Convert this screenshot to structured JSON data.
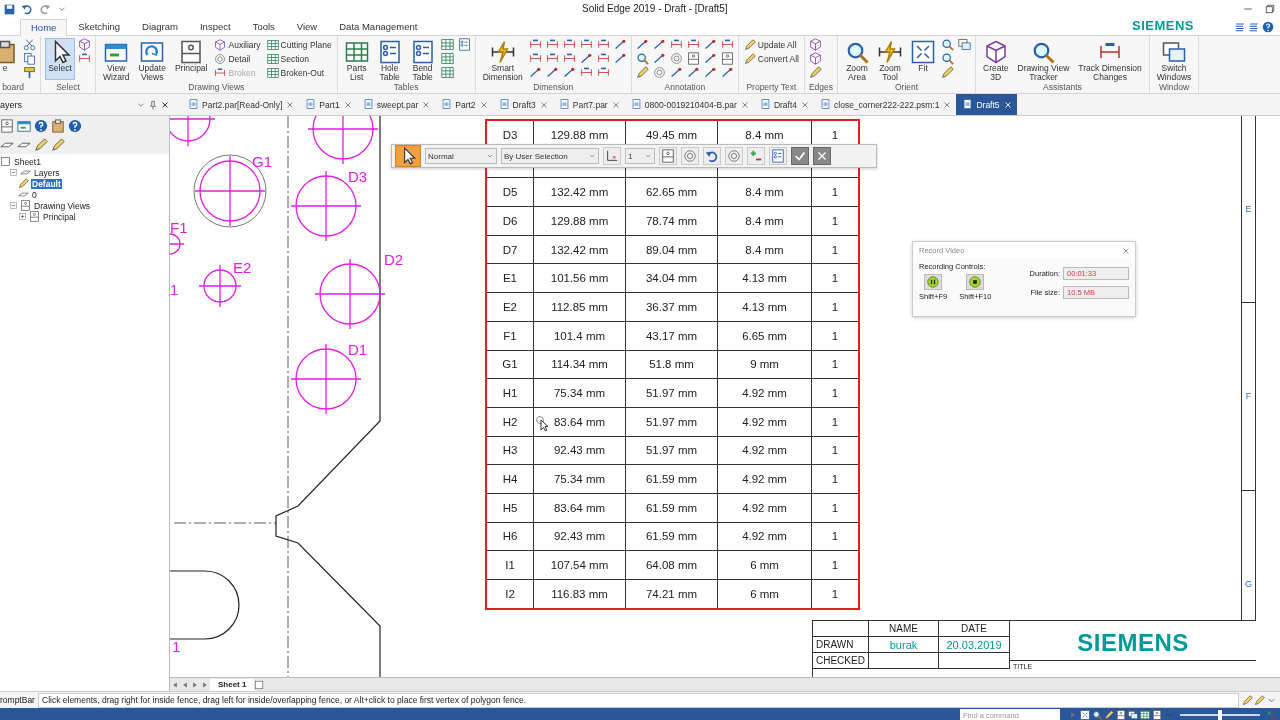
{
  "title_bar": {
    "title": "Solid Edge 2019 - Draft - [Draft5]"
  },
  "ribbon": {
    "tabs": [
      {
        "label": "Home",
        "selected": true
      },
      {
        "label": "Sketching",
        "selected": false
      },
      {
        "label": "Diagram",
        "selected": false
      },
      {
        "label": "Inspect",
        "selected": false
      },
      {
        "label": "Tools",
        "selected": false
      },
      {
        "label": "View",
        "selected": false
      },
      {
        "label": "Data Management",
        "selected": false
      }
    ],
    "logo": "SIEMENS",
    "groups": [
      {
        "label": "board",
        "buttons": [
          {
            "kind": "large",
            "label": "e",
            "active": false
          }
        ]
      },
      {
        "label": "Select",
        "buttons": [
          {
            "kind": "large",
            "label": "Select",
            "active": true
          }
        ]
      },
      {
        "label": "Drawing Views",
        "buttons": [
          {
            "kind": "large",
            "label": "View\nWizard",
            "active": false
          },
          {
            "kind": "large",
            "label": "Update\nViews",
            "active": false
          },
          {
            "kind": "large",
            "label": "Principal",
            "active": false
          },
          {
            "kind": "small",
            "label": "Auxiliary",
            "disabled": false
          },
          {
            "kind": "small",
            "label": "Detail",
            "disabled": false
          },
          {
            "kind": "small",
            "label": "Broken",
            "disabled": true
          },
          {
            "kind": "small",
            "label": "Cutting Plane",
            "disabled": false
          },
          {
            "kind": "small",
            "label": "Section",
            "disabled": false
          },
          {
            "kind": "small",
            "label": "Broken-Out",
            "disabled": false
          }
        ]
      },
      {
        "label": "Tables",
        "buttons": [
          {
            "kind": "large",
            "label": "Parts\nList",
            "active": false
          },
          {
            "kind": "large",
            "label": "Hole\nTable",
            "active": false
          },
          {
            "kind": "large",
            "label": "Bend\nTable",
            "active": false
          }
        ]
      },
      {
        "label": "Dimension",
        "buttons": [
          {
            "kind": "large",
            "label": "Smart\nDimension",
            "active": false
          }
        ]
      },
      {
        "label": "Annotation"
      },
      {
        "label": "Property Text",
        "buttons": [
          {
            "kind": "small",
            "label": "Update All",
            "disabled": false
          },
          {
            "kind": "small",
            "label": "Convert All",
            "disabled": false
          }
        ]
      },
      {
        "label": "Edges"
      },
      {
        "label": "Orient",
        "buttons": [
          {
            "kind": "large",
            "label": "Zoom\nArea",
            "active": false
          },
          {
            "kind": "large",
            "label": "Zoom\nTool",
            "active": false
          },
          {
            "kind": "large",
            "label": "Fit",
            "active": false
          }
        ]
      },
      {
        "label": "Assistants",
        "buttons": [
          {
            "kind": "large",
            "label": "Create\n3D",
            "active": false
          },
          {
            "kind": "large",
            "label": "Drawing View\nTracker",
            "active": false
          },
          {
            "kind": "large",
            "label": "Track Dimension\nChanges",
            "active": false
          }
        ]
      },
      {
        "label": "Window",
        "buttons": [
          {
            "kind": "large",
            "label": "Switch\nWindows",
            "active": false
          }
        ]
      }
    ]
  },
  "panel": {
    "title": "ayers"
  },
  "document_tabs": [
    {
      "label": "Part2.par[Read-Only]",
      "selected": false
    },
    {
      "label": "Part1",
      "selected": false
    },
    {
      "label": "sweept.par",
      "selected": false
    },
    {
      "label": "Part2",
      "selected": false
    },
    {
      "label": "Draft3",
      "selected": false
    },
    {
      "label": "Part7.par",
      "selected": false
    },
    {
      "label": "0800-0019210404-B.par",
      "selected": false
    },
    {
      "label": "Draft4",
      "selected": false
    },
    {
      "label": "close_corner222-222.psm:1",
      "selected": false
    },
    {
      "label": "Draft5",
      "selected": true
    }
  ],
  "tree": [
    {
      "label": "Sheet1",
      "selected": false,
      "children": [
        {
          "label": "Layers",
          "selected": false,
          "expanded": true,
          "children": [
            {
              "label": "Default",
              "selected": true
            },
            {
              "label": "0",
              "selected": false
            }
          ]
        },
        {
          "label": "Drawing Views",
          "selected": false,
          "expanded": true,
          "children": [
            {
              "label": "Principal",
              "selected": false,
              "expanded": false
            }
          ]
        }
      ]
    }
  ],
  "drawing": {
    "hole_labels": [
      "G1",
      "D3",
      "F1",
      "E2",
      "D2",
      "1",
      "D1",
      "1"
    ]
  },
  "hole_table": {
    "rows": [
      {
        "cells": [
          "D3",
          "129.88 mm",
          "49.45 mm",
          "8.4 mm",
          "1"
        ]
      },
      {
        "covered": true
      },
      {
        "cells": [
          "D5",
          "132.42 mm",
          "62.65 mm",
          "8.4 mm",
          "1"
        ]
      },
      {
        "cells": [
          "D6",
          "129.88 mm",
          "78.74 mm",
          "8.4 mm",
          "1"
        ]
      },
      {
        "cells": [
          "D7",
          "132.42 mm",
          "89.04 mm",
          "8.4 mm",
          "1"
        ]
      },
      {
        "cells": [
          "E1",
          "101.56 mm",
          "34.04 mm",
          "4.13 mm",
          "1"
        ]
      },
      {
        "cells": [
          "E2",
          "112.85 mm",
          "36.37 mm",
          "4.13 mm",
          "1"
        ]
      },
      {
        "cells": [
          "F1",
          "101.4 mm",
          "43.17 mm",
          "6.65 mm",
          "1"
        ]
      },
      {
        "cells": [
          "G1",
          "114.34 mm",
          "51.8 mm",
          "9 mm",
          "1"
        ]
      },
      {
        "cells": [
          "H1",
          "75.34 mm",
          "51.97 mm",
          "4.92 mm",
          "1"
        ]
      },
      {
        "cells": [
          "H2",
          "83.64 mm",
          "51.97 mm",
          "4.92 mm",
          "1"
        ]
      },
      {
        "cells": [
          "H3",
          "92.43 mm",
          "51.97 mm",
          "4.92 mm",
          "1"
        ]
      },
      {
        "cells": [
          "H4",
          "75.34 mm",
          "61.59 mm",
          "4.92 mm",
          "1"
        ]
      },
      {
        "cells": [
          "H5",
          "83.64 mm",
          "61.59 mm",
          "4.92 mm",
          "1"
        ]
      },
      {
        "cells": [
          "H6",
          "92.43 mm",
          "61.59 mm",
          "4.92 mm",
          "1"
        ]
      },
      {
        "cells": [
          "I1",
          "107.54 mm",
          "64.08 mm",
          "6 mm",
          "1"
        ]
      },
      {
        "cells": [
          "I2",
          "116.83 mm",
          "74.21 mm",
          "6 mm",
          "1"
        ]
      }
    ]
  },
  "selection_toolbar": {
    "select_active": true,
    "mode": "Normal",
    "selection": "By User Selection",
    "count": "1"
  },
  "record_video": {
    "title": "Record Video",
    "controls_label": "Recording Controls:",
    "buttons": [
      {
        "shortcut": "Shift+F9"
      },
      {
        "shortcut": "Shift+F10"
      }
    ],
    "fields": [
      {
        "label": "Duration:",
        "value": "00:01:33"
      },
      {
        "label": "File size:",
        "value": "10.5 MB"
      }
    ]
  },
  "zone_letters": [
    "E",
    "F",
    "G"
  ],
  "title_block": {
    "headers": [
      "NAME",
      "DATE"
    ],
    "rows": [
      {
        "label": "DRAWN",
        "name": "burak",
        "date": "20.03.2019"
      },
      {
        "label": "CHECKED"
      }
    ],
    "logo": "SIEMENS",
    "title_label": "TITLE"
  },
  "sheet_tabs": [
    {
      "label": "Sheet 1",
      "selected": true
    }
  ],
  "prompt_bar": {
    "label": "romptBar",
    "text": "Click elements, drag right for inside fence, drag left for inside/overlapping fence, or Alt+click to place first vertex of polygon fence."
  },
  "status_bar": {
    "search": {
      "placeholder": "Find a command"
    },
    "zoom": {
      "level": 0.5
    }
  }
}
